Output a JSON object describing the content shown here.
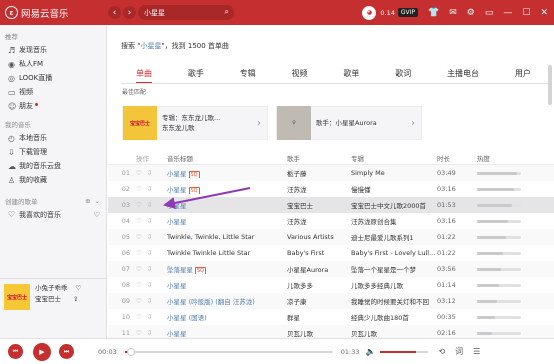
{
  "app": {
    "title": "网易云音乐",
    "logo_glyph": "ε"
  },
  "topbar": {
    "search_value": "小星星",
    "user_level": "0.14",
    "vip_label": "GVIP",
    "back_glyph": "‹",
    "forward_glyph": "›"
  },
  "sidebar": {
    "recommend_header": "推荐",
    "recommend_items": [
      {
        "icon": "♬",
        "label": "发现音乐"
      },
      {
        "icon": "📻",
        "label": "私人FM"
      },
      {
        "icon": "◎",
        "label": "LOOK直播"
      },
      {
        "icon": "▭",
        "label": "视频"
      },
      {
        "icon": "☺",
        "label": "朋友"
      }
    ],
    "my_music_header": "我的音乐",
    "my_music_items": [
      {
        "icon": "◴",
        "label": "本地音乐"
      },
      {
        "icon": "⇩",
        "label": "下载管理"
      },
      {
        "icon": "☁",
        "label": "我的音乐云盘"
      },
      {
        "icon": "♙",
        "label": "我的收藏"
      }
    ],
    "created_header": "创建的歌单",
    "created_items": [
      {
        "icon": "♡",
        "label": "我喜欢的音乐"
      }
    ]
  },
  "mini_player": {
    "art_text": "宝宝巴士",
    "song": "小兔子乖乖",
    "artist": "宝宝巴士"
  },
  "main": {
    "result_prefix": "搜索 \"",
    "keyword": "小星星",
    "result_suffix": "\"，找到 1500 首单曲",
    "tabs": [
      "单曲",
      "歌手",
      "专辑",
      "视频",
      "歌单",
      "歌词",
      "主播电台",
      "用户"
    ],
    "best_match_label": "最佳匹配",
    "best_cards": [
      {
        "pic_text": "宝宝巴士",
        "line1": "专辑：东东龙儿歌...",
        "line2": "东东龙儿歌"
      },
      {
        "pic_text": "",
        "line1": "歌手：小星星Aurora",
        "line2": ""
      }
    ]
  },
  "table": {
    "headers": [
      "操作",
      "音乐标题",
      "歌手",
      "专辑",
      "时长",
      "热度"
    ],
    "rows": [
      {
        "num": "01",
        "title": "小星星",
        "badge": "SQ",
        "singer": "栀子藤",
        "album": "Simply Me",
        "duration": "03:49",
        "heat": 0.9,
        "title_hl": true
      },
      {
        "num": "02",
        "title": "小星星",
        "badge": "SQ",
        "singer": "汪苏泷",
        "album": "慢慢懂",
        "duration": "03:16",
        "heat": 0.85,
        "title_hl": true
      },
      {
        "num": "03",
        "title": "小星星",
        "badge": "",
        "singer": "宝宝巴士",
        "album": "宝宝巴士中文儿歌2000首",
        "duration": "01:53",
        "heat": 0.8,
        "title_hl": true,
        "selected": true
      },
      {
        "num": "04",
        "title": "小星星",
        "badge": "",
        "singer": "汪苏泷",
        "album": "汪苏泷原创合集",
        "duration": "03:16",
        "heat": 0.7,
        "title_hl": true
      },
      {
        "num": "05",
        "title": "Twinkle, Twinkle, Little Star",
        "badge": "",
        "singer": "Various Artists",
        "album": "迪士尼最爱儿歌系列1",
        "duration": "01:22",
        "heat": 0.65,
        "title_hl": false
      },
      {
        "num": "06",
        "title": "Twinkle Twinkle Little Star",
        "badge": "",
        "singer": "Baby's First",
        "album": "Baby's First - Lovely Lull...",
        "duration": "01:22",
        "heat": 0.6,
        "title_hl": false
      },
      {
        "num": "07",
        "title": "坠落星星",
        "badge": "SQ",
        "singer": "小星星Aurora",
        "album": "坠落一个星星是一个梦",
        "duration": "03:56",
        "heat": 0.55,
        "title_hl": true
      },
      {
        "num": "08",
        "title": "小星星",
        "badge": "",
        "singer": "儿歌多多",
        "album": "儿歌多多经典儿歌",
        "duration": "01:14",
        "heat": 0.5,
        "title_hl": true
      },
      {
        "num": "09",
        "title": "小星星 (吟般版) (翻自 汪苏泷)",
        "badge": "",
        "singer": "凉子康",
        "album": "我睡觉的时候要关灯和不回",
        "duration": "03:12",
        "heat": 0.45,
        "title_hl": true
      },
      {
        "num": "10",
        "title": "小星星 (国语)",
        "badge": "",
        "singer": "群星",
        "album": "经典少儿歌曲180首",
        "duration": "00:35",
        "heat": 0.4,
        "title_hl": true
      },
      {
        "num": "11",
        "title": "小星星",
        "badge": "",
        "singer": "贝瓦儿歌",
        "album": "贝瓦儿歌",
        "duration": "02:16",
        "heat": 0.35,
        "title_hl": true
      }
    ]
  },
  "player": {
    "current_time": "00:03",
    "total_time": "01:33",
    "progress": 0.03,
    "volume": 0.75
  }
}
